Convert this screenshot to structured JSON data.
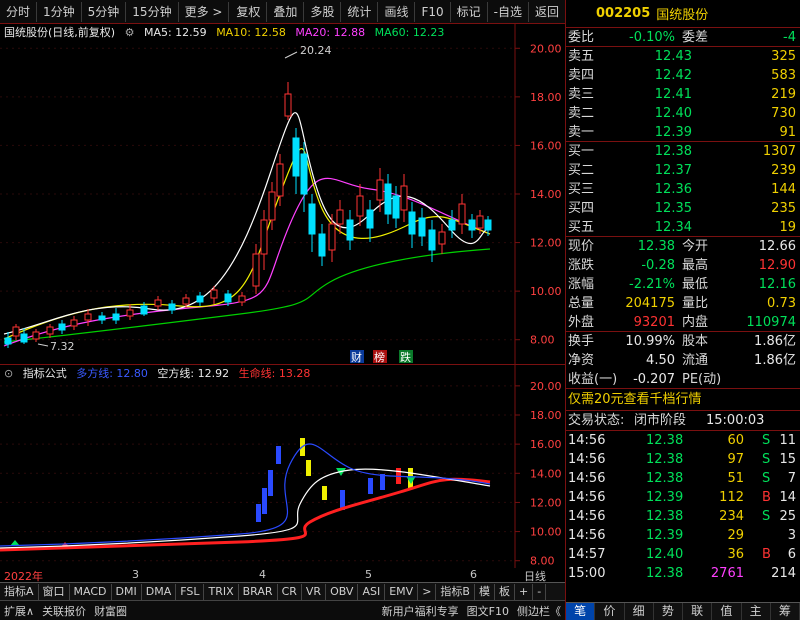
{
  "toolbar": {
    "left": [
      "分时",
      "1分钟",
      "5分钟",
      "15分钟",
      "更多 >"
    ],
    "right": [
      "复权",
      "叠加",
      "多股",
      "统计",
      "画线",
      "F10",
      "标记",
      "-自选",
      "返回"
    ]
  },
  "main_legend": {
    "title": "国统股份(日线,前复权)",
    "ma5": "MA5: 12.59",
    "ma10": "MA10: 12.58",
    "ma20": "MA20: 12.88",
    "ma60": "MA60: 12.23"
  },
  "main_annotations": {
    "high_label": "20.24",
    "low_label": "7.32",
    "badge_cai": "财",
    "badge_bang": "榜",
    "badge_die": "跌"
  },
  "ind_legend": {
    "name": "指标公式",
    "duo": "多方线: 12.80",
    "kong": "空方线: 12.92",
    "sheng": "生命线: 13.28"
  },
  "dates": {
    "d1": "2022年",
    "d2": "3",
    "d3": "4",
    "d4": "5",
    "d5": "6",
    "period": "日线"
  },
  "bottom_tabs": [
    "指标A",
    "窗口",
    "MACD",
    "DMI",
    "DMA",
    "FSL",
    "TRIX",
    "BRAR",
    "CR",
    "VR",
    "OBV",
    "ASI",
    "EMV",
    ">",
    "指标B",
    "模",
    "板",
    "+",
    "-"
  ],
  "status_bar": [
    "扩展∧",
    "关联报价",
    "财富圈",
    "新用户福利专享",
    "图文F10",
    "侧边栏《"
  ],
  "quote": {
    "code": "002205",
    "name": "国统股份",
    "weibi_label": "委比",
    "weibi": "-0.10%",
    "weicha_label": "委差",
    "weicha": "-4",
    "sells": [
      {
        "label": "卖五",
        "price": "12.43",
        "vol": "325"
      },
      {
        "label": "卖四",
        "price": "12.42",
        "vol": "583"
      },
      {
        "label": "卖三",
        "price": "12.41",
        "vol": "219"
      },
      {
        "label": "卖二",
        "price": "12.40",
        "vol": "730"
      },
      {
        "label": "卖一",
        "price": "12.39",
        "vol": "91"
      }
    ],
    "buys": [
      {
        "label": "买一",
        "price": "12.38",
        "vol": "1307"
      },
      {
        "label": "买二",
        "price": "12.37",
        "vol": "239"
      },
      {
        "label": "买三",
        "price": "12.36",
        "vol": "144"
      },
      {
        "label": "买四",
        "price": "12.35",
        "vol": "235"
      },
      {
        "label": "买五",
        "price": "12.34",
        "vol": "19"
      }
    ],
    "stats": [
      {
        "l1": "现价",
        "v1": "12.38",
        "l2": "今开",
        "v2": "12.66"
      },
      {
        "l1": "涨跌",
        "v1": "-0.28",
        "l2": "最高",
        "v2": "12.90"
      },
      {
        "l1": "涨幅",
        "v1": "-2.21%",
        "l2": "最低",
        "v2": "12.16"
      },
      {
        "l1": "总量",
        "v1": "204175",
        "l2": "量比",
        "v2": "0.73"
      },
      {
        "l1": "外盘",
        "v1": "93201",
        "l2": "内盘",
        "v2": "110974"
      }
    ],
    "stats2": [
      {
        "l1": "换手",
        "v1": "10.99%",
        "l2": "股本",
        "v2": "1.86亿"
      },
      {
        "l1": "净资",
        "v1": "4.50",
        "l2": "流通",
        "v2": "1.86亿"
      },
      {
        "l1": "收益(一)",
        "v1": "-0.207",
        "l2": "PE(动)",
        "v2": ""
      }
    ],
    "promo": "仅需20元查看千档行情",
    "trade_state_label": "交易状态:",
    "trade_state": "闭市阶段",
    "trade_time": "15:00:03",
    "ticks": [
      {
        "t": "14:56",
        "p": "12.38",
        "v": "60",
        "d": "S",
        "n": "11"
      },
      {
        "t": "14:56",
        "p": "12.38",
        "v": "97",
        "d": "S",
        "n": "15"
      },
      {
        "t": "14:56",
        "p": "12.38",
        "v": "51",
        "d": "S",
        "n": "7"
      },
      {
        "t": "14:56",
        "p": "12.39",
        "v": "112",
        "d": "B",
        "n": "14"
      },
      {
        "t": "14:56",
        "p": "12.38",
        "v": "234",
        "d": "S",
        "n": "25"
      },
      {
        "t": "14:56",
        "p": "12.39",
        "v": "29",
        "d": "",
        "n": "3"
      },
      {
        "t": "14:57",
        "p": "12.40",
        "v": "36",
        "d": "B",
        "n": "6"
      },
      {
        "t": "15:00",
        "p": "12.38",
        "v": "2761",
        "d": "",
        "n": "214"
      }
    ],
    "tabs": [
      "笔",
      "价",
      "细",
      "势",
      "联",
      "值",
      "主",
      "筹"
    ]
  },
  "chart_data": [
    {
      "type": "candlestick",
      "title": "国统股份(日线,前复权)",
      "ylim": [
        7.0,
        21.0
      ],
      "y_ticks": [
        "8.00",
        "10.00",
        "12.00",
        "14.00",
        "16.00",
        "18.00",
        "20.00"
      ],
      "x_ticks": [
        "2022年",
        "3",
        "4",
        "5",
        "6"
      ],
      "series": [
        {
          "name": "MA5",
          "last": 12.59
        },
        {
          "name": "MA10",
          "last": 12.58
        },
        {
          "name": "MA20",
          "last": 12.88
        },
        {
          "name": "MA60",
          "last": 12.23
        }
      ],
      "annotations": [
        "20.24",
        "7.32"
      ]
    },
    {
      "type": "line",
      "title": "指标公式",
      "ylim": [
        7.5,
        21.5
      ],
      "y_ticks": [
        "8.00",
        "10.00",
        "12.00",
        "14.00",
        "16.00",
        "18.00",
        "20.00"
      ],
      "series": [
        {
          "name": "多方线",
          "last": 12.8
        },
        {
          "name": "空方线",
          "last": 12.92
        },
        {
          "name": "生命线",
          "last": 13.28
        }
      ]
    }
  ],
  "colors": {
    "up": "#ff3333",
    "down": "#00e05a",
    "ma5": "#ffffff",
    "ma10": "#f0f000",
    "ma20": "#ff40ff",
    "ma60": "#00d000",
    "border": "#7a1010"
  }
}
